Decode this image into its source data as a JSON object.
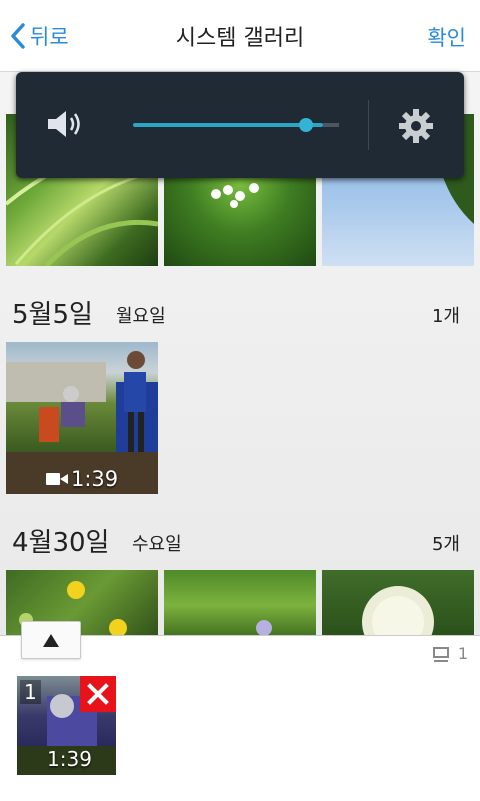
{
  "header": {
    "back_label": "뒤로",
    "title": "시스템 갤러리",
    "confirm_label": "확인"
  },
  "volume_panel": {
    "level_percent": 88,
    "speaker_icon": "speaker-icon",
    "settings_icon": "gear-icon"
  },
  "sections": [
    {
      "date": "5월5일",
      "weekday": "월요일",
      "count": "1개",
      "items": [
        {
          "type": "video",
          "duration": "1:39"
        }
      ]
    },
    {
      "date": "4월30일",
      "weekday": "수요일",
      "count": "5개",
      "items": [
        {
          "type": "photo"
        },
        {
          "type": "photo"
        },
        {
          "type": "photo"
        }
      ]
    }
  ],
  "tray": {
    "selected_count": "1",
    "selected": [
      {
        "index": "1",
        "duration": "1:39"
      }
    ]
  },
  "colors": {
    "accent": "#2b8bd8",
    "volume_bar": "#2aa5c4",
    "remove_red": "#e8121a"
  }
}
